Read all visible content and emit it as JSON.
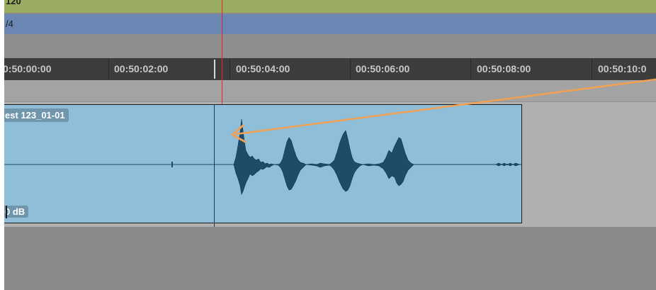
{
  "tempo_ruler": {
    "value": "120"
  },
  "meter_ruler": {
    "value": "/4"
  },
  "timecode_ruler": {
    "labels": [
      "0:50:00:00",
      "00:50:02:00",
      "00:50:04:00",
      "00:50:06:00",
      "00:50:08:00",
      "00:50:10:0"
    ]
  },
  "clip": {
    "name": "est 123_01-01",
    "gain": "0 dB",
    "color": "#8fbfd8"
  },
  "colors": {
    "playhead": "#e0262e",
    "annotation_arrow": "#f2a052",
    "waveform": "#1e4b68"
  },
  "icons": {
    "annotation": "arrow-annotation-icon"
  }
}
